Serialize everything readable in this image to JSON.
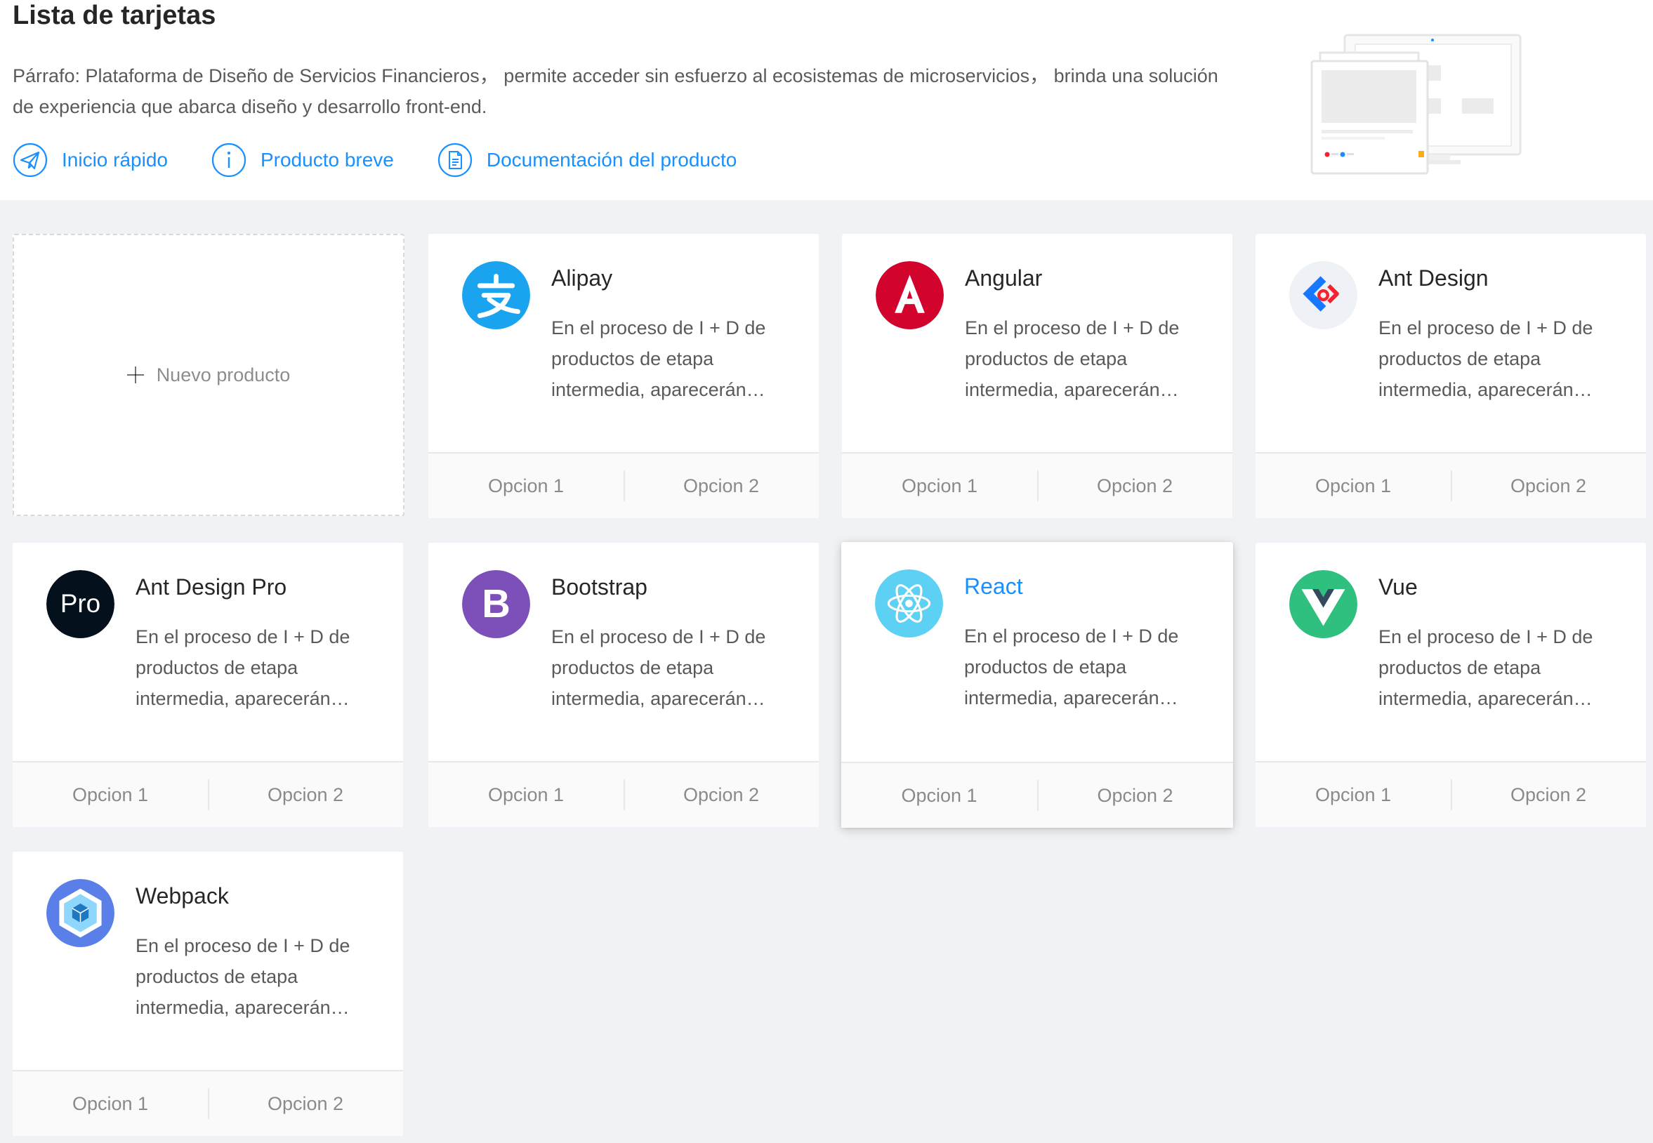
{
  "header": {
    "title": "Lista de tarjetas",
    "description": "Párrafo: Plataforma de Diseño de Servicios Financieros， permite acceder sin esfuerzo al ecosistemas de microservicios， brinda una solución de experiencia que abarca diseño y desarrollo front-end.",
    "links": [
      {
        "label": "Inicio rápido",
        "icon": "paper-plane-icon"
      },
      {
        "label": "Producto breve",
        "icon": "info-circle-icon"
      },
      {
        "label": "Documentación del producto",
        "icon": "document-icon"
      }
    ]
  },
  "new_card": {
    "label": "Nuevo producto",
    "icon": "plus-icon"
  },
  "cards": [
    {
      "title": "Alipay",
      "description": "En el proceso de I + D de productos de etapa intermedia, aparecerán diferentes especificaciones y métodos de implementación",
      "avatar": "alipay-logo",
      "actions": [
        "Opcion 1",
        "Opcion 2"
      ]
    },
    {
      "title": "Angular",
      "description": "En el proceso de I + D de productos de etapa intermedia, aparecerán diferentes especificaciones y métodos de implementación",
      "avatar": "angular-logo",
      "actions": [
        "Opcion 1",
        "Opcion 2"
      ]
    },
    {
      "title": "Ant Design",
      "description": "En el proceso de I + D de productos de etapa intermedia, aparecerán diferentes especificaciones y métodos de implementación",
      "avatar": "ant-design-logo",
      "actions": [
        "Opcion 1",
        "Opcion 2"
      ]
    },
    {
      "title": "Ant Design Pro",
      "description": "En el proceso de I + D de productos de etapa intermedia, aparecerán diferentes especificaciones y métodos de implementación",
      "avatar": "ant-design-pro-logo",
      "avatar_text": "Pro",
      "actions": [
        "Opcion 1",
        "Opcion 2"
      ]
    },
    {
      "title": "Bootstrap",
      "description": "En el proceso de I + D de productos de etapa intermedia, aparecerán diferentes especificaciones y métodos de implementación",
      "avatar": "bootstrap-logo",
      "avatar_text": "B",
      "actions": [
        "Opcion 1",
        "Opcion 2"
      ]
    },
    {
      "title": "React",
      "description": "En el proceso de I + D de productos de etapa intermedia, aparecerán diferentes especificaciones y métodos de implementación",
      "avatar": "react-logo",
      "hovered": true,
      "actions": [
        "Opcion 1",
        "Opcion 2"
      ]
    },
    {
      "title": "Vue",
      "description": "En el proceso de I + D de productos de etapa intermedia, aparecerán diferentes especificaciones y métodos de implementación",
      "avatar": "vue-logo",
      "actions": [
        "Opcion 1",
        "Opcion 2"
      ]
    },
    {
      "title": "Webpack",
      "description": "En el proceso de I + D de productos de etapa intermedia, aparecerán diferentes especificaciones y métodos de implementación",
      "avatar": "webpack-logo",
      "actions": [
        "Opcion 1",
        "Opcion 2"
      ]
    }
  ],
  "colors": {
    "link": "#1890ff",
    "background": "#f0f2f5",
    "alipay": "#1aa3ee",
    "angular": "#d2042d",
    "ant_design_bg": "#f0f2f5",
    "ant_design_pro": "#04101c",
    "bootstrap": "#7d4fb8",
    "react": "#5dd1f3",
    "vue": "#2fbf7e",
    "webpack": "#5b7fe8"
  }
}
